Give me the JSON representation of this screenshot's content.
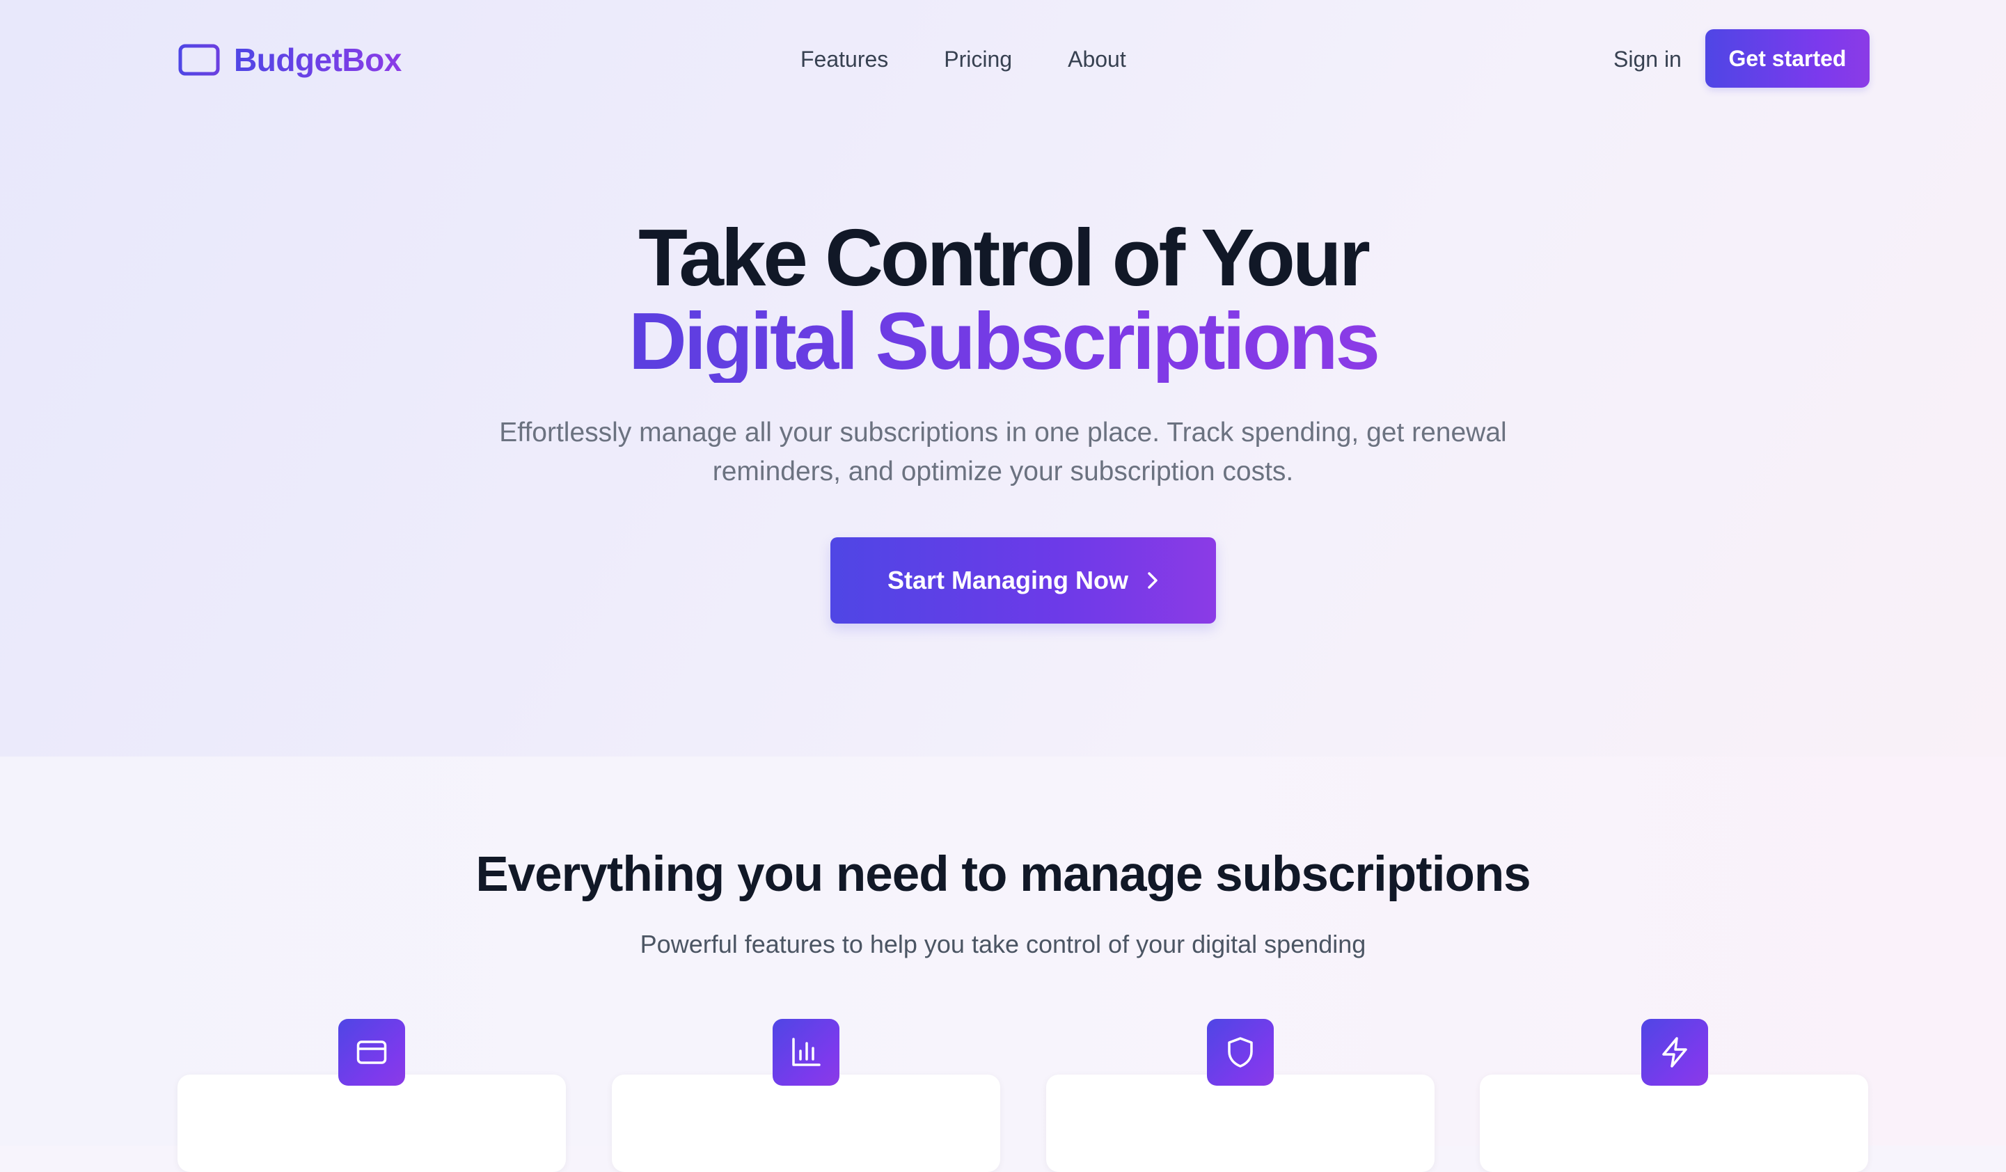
{
  "brand": {
    "name": "BudgetBox",
    "icon": "credit-card-icon",
    "colors": {
      "primary": "#4f46e5",
      "secondary": "#8b3be6"
    }
  },
  "nav": {
    "links": [
      "Features",
      "Pricing",
      "About"
    ],
    "sign_in": "Sign in",
    "get_started": "Get started"
  },
  "hero": {
    "title_line1": "Take Control of Your",
    "title_line2": "Digital Subscriptions",
    "subtitle": "Effortlessly manage all your subscriptions in one place. Track spending, get renewal reminders, and optimize your subscription costs.",
    "cta_label": "Start Managing Now",
    "cta_icon": "chevron-right-icon"
  },
  "features": {
    "title": "Everything you need to manage subscriptions",
    "subtitle": "Powerful features to help you take control of your digital spending",
    "icons": [
      "credit-card-icon",
      "bar-chart-icon",
      "shield-icon",
      "lightning-icon"
    ]
  }
}
